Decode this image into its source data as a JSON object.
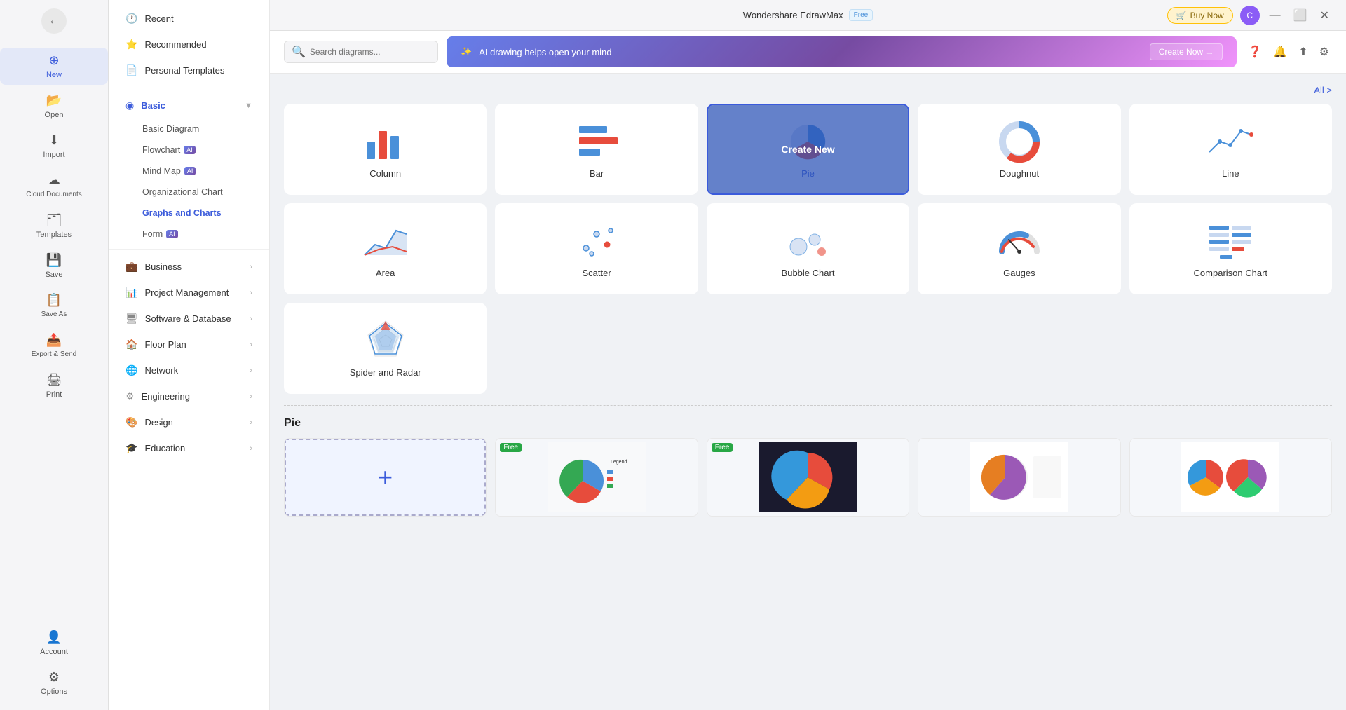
{
  "app": {
    "title": "Wondershare EdrawMax",
    "free_badge": "Free",
    "buy_now_label": "Buy Now",
    "user_initial": "C"
  },
  "toolbar": {
    "search_placeholder": "Search diagrams...",
    "ai_banner_text": "AI drawing helps open your mind",
    "create_now_label": "Create Now →",
    "all_label": "All >"
  },
  "sidebar_narrow": {
    "items": [
      {
        "id": "new",
        "label": "New",
        "icon": "＋",
        "active": true
      },
      {
        "id": "open",
        "label": "Open",
        "icon": "📂"
      },
      {
        "id": "import",
        "label": "Import",
        "icon": "⬇"
      },
      {
        "id": "cloud",
        "label": "Cloud Documents",
        "icon": "☁"
      },
      {
        "id": "templates",
        "label": "Templates",
        "icon": "🗂"
      },
      {
        "id": "save",
        "label": "Save",
        "icon": "💾"
      },
      {
        "id": "save-as",
        "label": "Save As",
        "icon": "📋"
      },
      {
        "id": "export",
        "label": "Export & Send",
        "icon": "📤"
      },
      {
        "id": "print",
        "label": "Print",
        "icon": "🖨"
      }
    ],
    "bottom_items": [
      {
        "id": "account",
        "label": "Account",
        "icon": "👤"
      },
      {
        "id": "options",
        "label": "Options",
        "icon": "⚙"
      }
    ]
  },
  "sidebar_wide": {
    "menu_items": [
      {
        "id": "recent",
        "label": "Recent",
        "icon": "🕐",
        "has_arrow": false
      },
      {
        "id": "recommended",
        "label": "Recommended",
        "icon": "⭐",
        "has_arrow": false
      },
      {
        "id": "personal-templates",
        "label": "Personal Templates",
        "icon": "📄",
        "has_arrow": false
      }
    ],
    "categories": [
      {
        "id": "basic",
        "label": "Basic",
        "icon": "◉",
        "expanded": true,
        "sub_items": [
          {
            "id": "basic-diagram",
            "label": "Basic Diagram",
            "ai": false
          },
          {
            "id": "flowchart",
            "label": "Flowchart",
            "ai": true
          },
          {
            "id": "mind-map",
            "label": "Mind Map",
            "ai": true
          },
          {
            "id": "org-chart",
            "label": "Organizational Chart",
            "ai": false
          },
          {
            "id": "graphs-charts",
            "label": "Graphs and Charts",
            "ai": false,
            "active": true
          },
          {
            "id": "form",
            "label": "Form",
            "ai": true
          }
        ]
      },
      {
        "id": "business",
        "label": "Business",
        "icon": "💼",
        "has_arrow": true
      },
      {
        "id": "project-mgmt",
        "label": "Project Management",
        "icon": "📊",
        "has_arrow": true
      },
      {
        "id": "software-db",
        "label": "Software & Database",
        "icon": "🖥",
        "has_arrow": true
      },
      {
        "id": "floor-plan",
        "label": "Floor Plan",
        "icon": "🏠",
        "has_arrow": true
      },
      {
        "id": "network",
        "label": "Network",
        "icon": "🌐",
        "has_arrow": true
      },
      {
        "id": "engineering",
        "label": "Engineering",
        "icon": "⚙",
        "has_arrow": true
      },
      {
        "id": "design",
        "label": "Design",
        "icon": "🎨",
        "has_arrow": true
      },
      {
        "id": "education",
        "label": "Education",
        "icon": "🎓",
        "has_arrow": true
      }
    ]
  },
  "charts": [
    {
      "id": "column",
      "label": "Column",
      "selected": false
    },
    {
      "id": "bar",
      "label": "Bar",
      "selected": false
    },
    {
      "id": "pie",
      "label": "Pie",
      "selected": true,
      "create_new": true
    },
    {
      "id": "doughnut",
      "label": "Doughnut",
      "selected": false
    },
    {
      "id": "line",
      "label": "Line",
      "selected": false
    },
    {
      "id": "area",
      "label": "Area",
      "selected": false
    },
    {
      "id": "scatter",
      "label": "Scatter",
      "selected": false
    },
    {
      "id": "bubble",
      "label": "Bubble Chart",
      "selected": false
    },
    {
      "id": "gauges",
      "label": "Gauges",
      "selected": false
    },
    {
      "id": "comparison",
      "label": "Comparison Chart",
      "selected": false
    },
    {
      "id": "spider",
      "label": "Spider and Radar",
      "selected": false
    }
  ],
  "templates_section": {
    "title": "Pie",
    "add_new_label": "+"
  }
}
